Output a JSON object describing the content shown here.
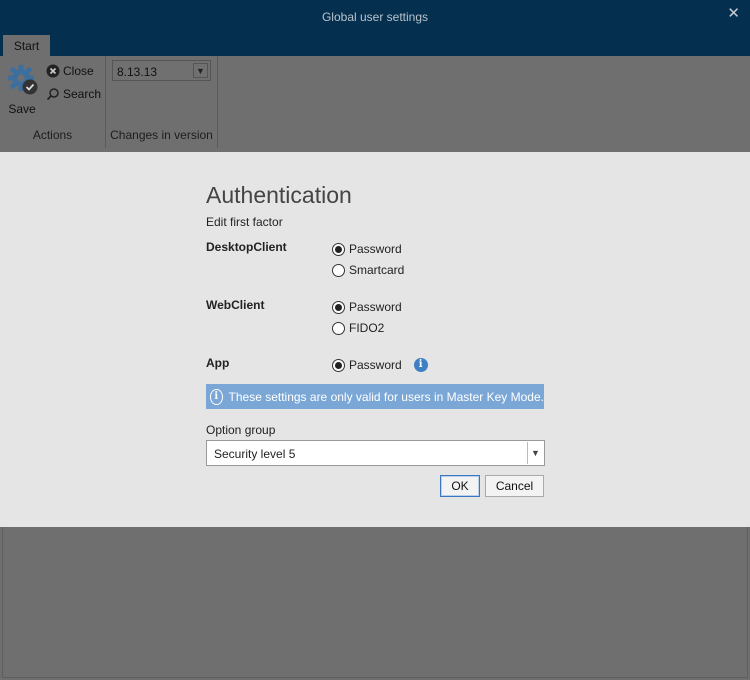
{
  "window": {
    "title": "Global user settings"
  },
  "tabs": [
    {
      "label": "Start"
    }
  ],
  "ribbon": {
    "actions": {
      "save_label": "Save",
      "close_label": "Close",
      "search_label": "Search",
      "group_label": "Actions"
    },
    "version": {
      "value": "8.13.13",
      "group_label": "Changes in version"
    }
  },
  "dialog": {
    "heading": "Authentication",
    "subheading": "Edit first factor",
    "desktop_client": {
      "label": "DesktopClient",
      "options": [
        {
          "label": "Password",
          "checked": true
        },
        {
          "label": "Smartcard",
          "checked": false
        }
      ]
    },
    "web_client": {
      "label": "WebClient",
      "options": [
        {
          "label": "Password",
          "checked": true
        },
        {
          "label": "FIDO2",
          "checked": false
        }
      ]
    },
    "app": {
      "label": "App",
      "options": [
        {
          "label": "Password",
          "checked": true
        }
      ]
    },
    "banner_text": "These settings are only valid for users in Master Key Mode.",
    "option_group": {
      "label": "Option group",
      "value": "Security level 5"
    },
    "ok_label": "OK",
    "cancel_label": "Cancel"
  },
  "colors": {
    "titlebar": "#052f4f",
    "overlay": "#6f6f6f",
    "dialog_bg": "#e5e5e5",
    "banner": "#7ba7d6",
    "info_icon": "#3f7fc4"
  }
}
